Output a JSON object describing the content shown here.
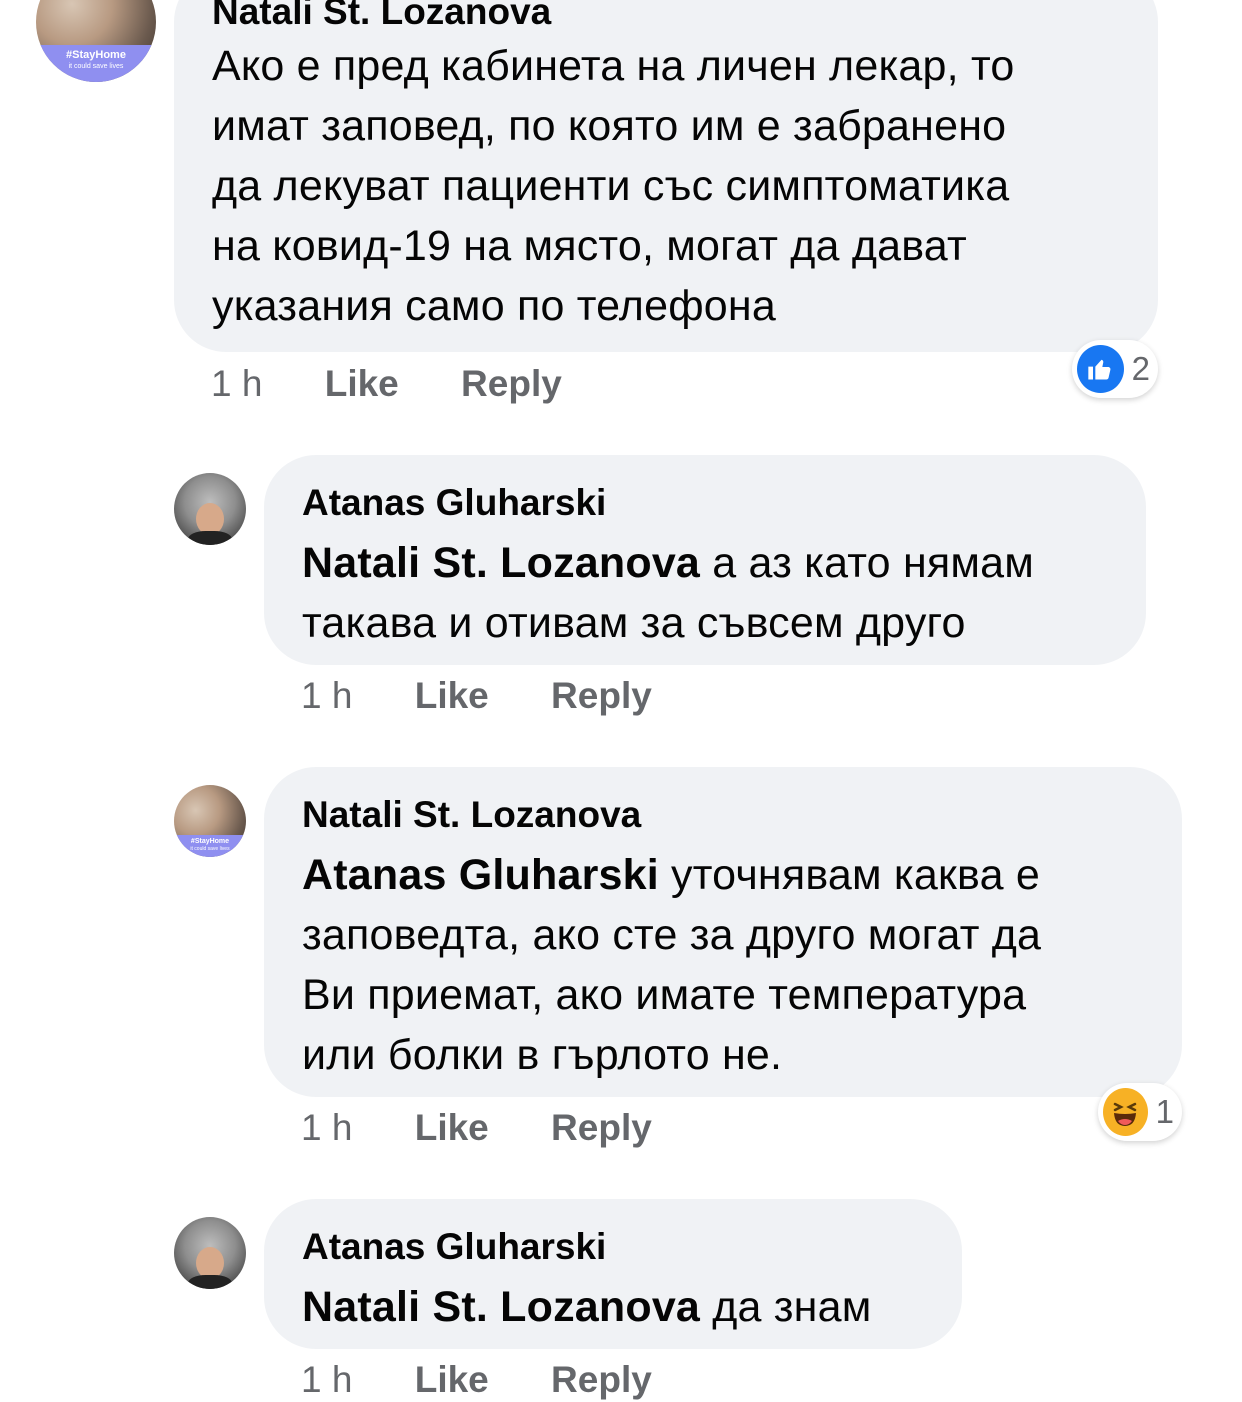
{
  "comments": [
    {
      "author": "Natali St. Lozanova",
      "mention": "",
      "text": "Ако е пред кабинета на личен лекар, то имат заповед, по която им е забранено да лекуват пациенти със симптоматика на ковид-19 на място, могат да дават указания само по телефона",
      "lines": [
        "Ако е пред кабинета на личен лекар, то",
        "имат заповед, по която им е забранено",
        "да лекуват пациенти със симптоматика",
        "на ковид-19 на място, могат да дават",
        "указания само по телефона"
      ],
      "avatar_badge": "#StayHome",
      "avatar_badge_sub": "it could save lives",
      "time": "1 h",
      "like_label": "Like",
      "reply_label": "Reply",
      "reaction": {
        "icon": "like-icon",
        "count": "2"
      }
    },
    {
      "author": "Atanas Gluharski",
      "mention": "Natali St. Lozanova",
      "line1_rest": " а аз като нямам",
      "line2": "такава и отивам за съвсем друго",
      "time": "1 h",
      "like_label": "Like",
      "reply_label": "Reply"
    },
    {
      "author": "Natali St. Lozanova",
      "mention": "Atanas Gluharski",
      "line1_rest": " уточнявам каква е",
      "line2": "заповедта, ако сте за друго могат да",
      "line3": "Ви приемат, ако имате температура",
      "line4": "или болки в гърлото не.",
      "avatar_badge": "#StayHome",
      "avatar_badge_sub": "it could save lives",
      "time": "1 h",
      "like_label": "Like",
      "reply_label": "Reply",
      "reaction": {
        "icon": "haha-icon",
        "count": "1"
      }
    },
    {
      "author": "Atanas Gluharski",
      "mention": "Natali St. Lozanova",
      "line1_rest": " да знам",
      "time": "1 h",
      "like_label": "Like",
      "reply_label": "Reply"
    }
  ],
  "colors": {
    "bubble": "#f0f2f5",
    "meta_text": "#65676b",
    "like_blue": "#1877f2",
    "haha_yellow": "#f7b125",
    "badge_purple": "#8f8ff0"
  }
}
